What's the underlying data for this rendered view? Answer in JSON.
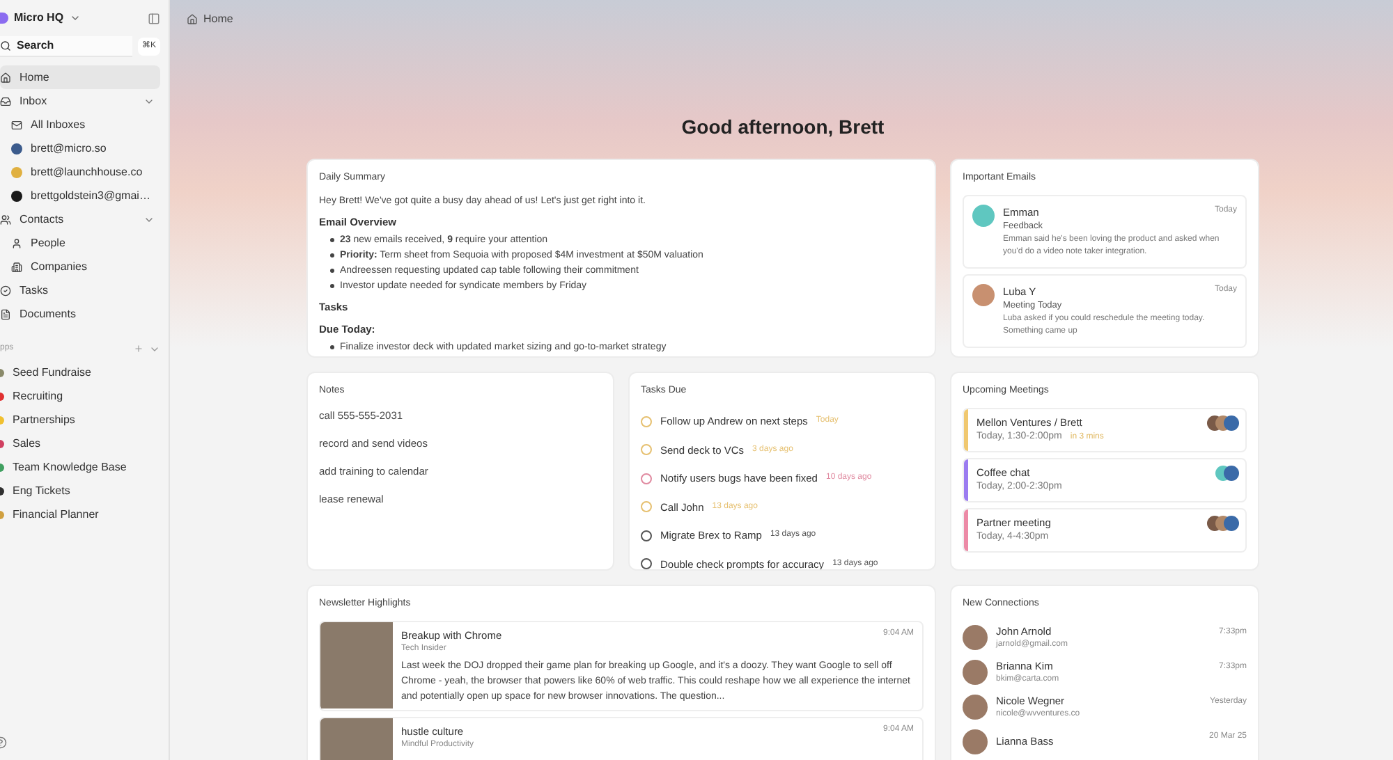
{
  "workspace": {
    "name": "Micro HQ"
  },
  "search": {
    "label": "Search",
    "shortcut": "⌘K"
  },
  "sidebar": {
    "items": [
      {
        "kind": "home",
        "label": "Home",
        "selected": true
      },
      {
        "kind": "inbox",
        "label": "Inbox",
        "selected": false,
        "expanded": true,
        "children": [
          {
            "kind": "inboxes",
            "label": "All Inboxes",
            "selected": false
          },
          {
            "kind": "account",
            "label": "brett@micro.so",
            "selected": false,
            "color": "#3b5b8c"
          },
          {
            "kind": "account",
            "label": "brett@launchhouse.co",
            "selected": false,
            "color": "#e0b040"
          },
          {
            "kind": "account",
            "label": "brettgoldstein3@gmai…",
            "selected": false,
            "color": "#1a1a1a"
          }
        ]
      },
      {
        "kind": "contacts",
        "label": "Contacts",
        "selected": false,
        "expanded": true,
        "children": [
          {
            "kind": "people",
            "label": "People",
            "selected": false
          },
          {
            "kind": "companies",
            "label": "Companies",
            "selected": false
          }
        ]
      },
      {
        "kind": "tasks",
        "label": "Tasks",
        "selected": false
      },
      {
        "kind": "documents",
        "label": "Documents",
        "selected": false
      }
    ]
  },
  "apps": {
    "heading": "pps",
    "expanded": true,
    "items": [
      {
        "label": "Seed Fundraise",
        "color": "#8a8a6a"
      },
      {
        "label": "Recruiting",
        "color": "#e03030"
      },
      {
        "label": "Partnerships",
        "color": "#f0c030"
      },
      {
        "label": "Sales",
        "color": "#d04060"
      },
      {
        "label": "Team Knowledge Base",
        "color": "#40a060"
      },
      {
        "label": "Eng Tickets",
        "color": "#303030"
      },
      {
        "label": "Financial Planner",
        "color": "#d0a040"
      }
    ]
  },
  "breadcrumb": "Home",
  "greeting": "Good afternoon, Brett",
  "daily_summary": {
    "title": "Daily Summary",
    "intro": "Hey Brett! We've got quite a busy day ahead of us! Let's just get right into it.",
    "sections": [
      {
        "heading": "Email Overview",
        "bullets": [
          "**23** new emails received, **9** require your attention",
          "**Priority:** Term sheet from Sequoia with proposed $4M investment at $50M valuation",
          "Andreessen requesting updated cap table following their commitment",
          "Investor update needed for syndicate members by Friday"
        ]
      },
      {
        "heading": "Tasks"
      },
      {
        "heading": "Due Today:",
        "bullets": [
          "Finalize investor deck with updated market sizing and go-to-market strategy"
        ]
      }
    ]
  },
  "important_emails": {
    "title": "Important Emails",
    "items": [
      {
        "sender": "Emman",
        "subject": "Feedback",
        "preview": "Emman said he's been loving the product and asked when you'd do a video note taker integration.",
        "date": "Today",
        "color": "#5fc7c0"
      },
      {
        "sender": "Luba Y",
        "subject": "Meeting Today",
        "preview": "Luba asked if you could reschedule the meeting today. Something came up",
        "date": "Today",
        "color": "#c89070"
      }
    ]
  },
  "notes": {
    "title": "Notes",
    "items": [
      "call 555-555-2031",
      "record and send videos",
      "add training to calendar",
      "lease renewal"
    ]
  },
  "tasks_due": {
    "title": "Tasks Due",
    "items": [
      {
        "label": "Follow up Andrew on next steps",
        "due": "Today",
        "color": "#e6c070"
      },
      {
        "label": "Send deck to VCs",
        "due": "3 days ago",
        "color": "#e6c070"
      },
      {
        "label": "Notify users bugs have been fixed",
        "due": "10 days ago",
        "color": "#e08aa0"
      },
      {
        "label": "Call John",
        "due": "13 days ago",
        "color": "#e6c070"
      },
      {
        "label": "Migrate Brex to Ramp",
        "due": "13 days ago",
        "color": "#555555"
      },
      {
        "label": "Double check prompts for accuracy",
        "due": "13 days ago",
        "color": "#555555"
      }
    ]
  },
  "upcoming_meetings": {
    "title": "Upcoming Meetings",
    "items": [
      {
        "title": "Mellon Ventures / Brett",
        "time": "Today, 1:30-2:00pm",
        "soon": "in 3 mins",
        "color": "#f0c870",
        "attendees": [
          {
            "color": "#7a5a48"
          },
          {
            "color": "#b08868"
          },
          {
            "color": "#3a6aa8"
          }
        ]
      },
      {
        "title": "Coffee chat",
        "time": "Today, 2:00-2:30pm",
        "color": "#9b7cf0",
        "attendees": [
          {
            "color": "#5fc7c0"
          },
          {
            "color": "#3a6aa8"
          }
        ]
      },
      {
        "title": "Partner meeting",
        "time": "Today, 4-4:30pm",
        "color": "#ec8aa6",
        "attendees": [
          {
            "color": "#7a5a48"
          },
          {
            "color": "#b08868"
          },
          {
            "color": "#3a6aa8"
          }
        ]
      }
    ]
  },
  "newsletters": {
    "title": "Newsletter Highlights",
    "items": [
      {
        "title": "Breakup with Chrome",
        "source": "Tech Insider",
        "time": "9:04 AM",
        "excerpt": "Last week the DOJ dropped their game plan for breaking up Google, and it's a doozy. They want Google to sell off Chrome - yeah, the browser that powers like 60% of web traffic. This could reshape how we all experience the internet and potentially open up space for new browser innovations. The question..."
      },
      {
        "title": "hustle culture",
        "source": "Mindful Productivity",
        "time": "9:04 AM"
      }
    ]
  },
  "new_connections": {
    "title": "New Connections",
    "items": [
      {
        "name": "John Arnold",
        "email": "jarnold@gmail.com",
        "time": "7:33pm"
      },
      {
        "name": "Brianna Kim",
        "email": "bkim@carta.com",
        "time": "7:33pm"
      },
      {
        "name": "Nicole Wegner",
        "email": "nicole@wvventures.co",
        "time": "Yesterday"
      },
      {
        "name": "Lianna Bass",
        "time": "20 Mar 25"
      }
    ]
  }
}
